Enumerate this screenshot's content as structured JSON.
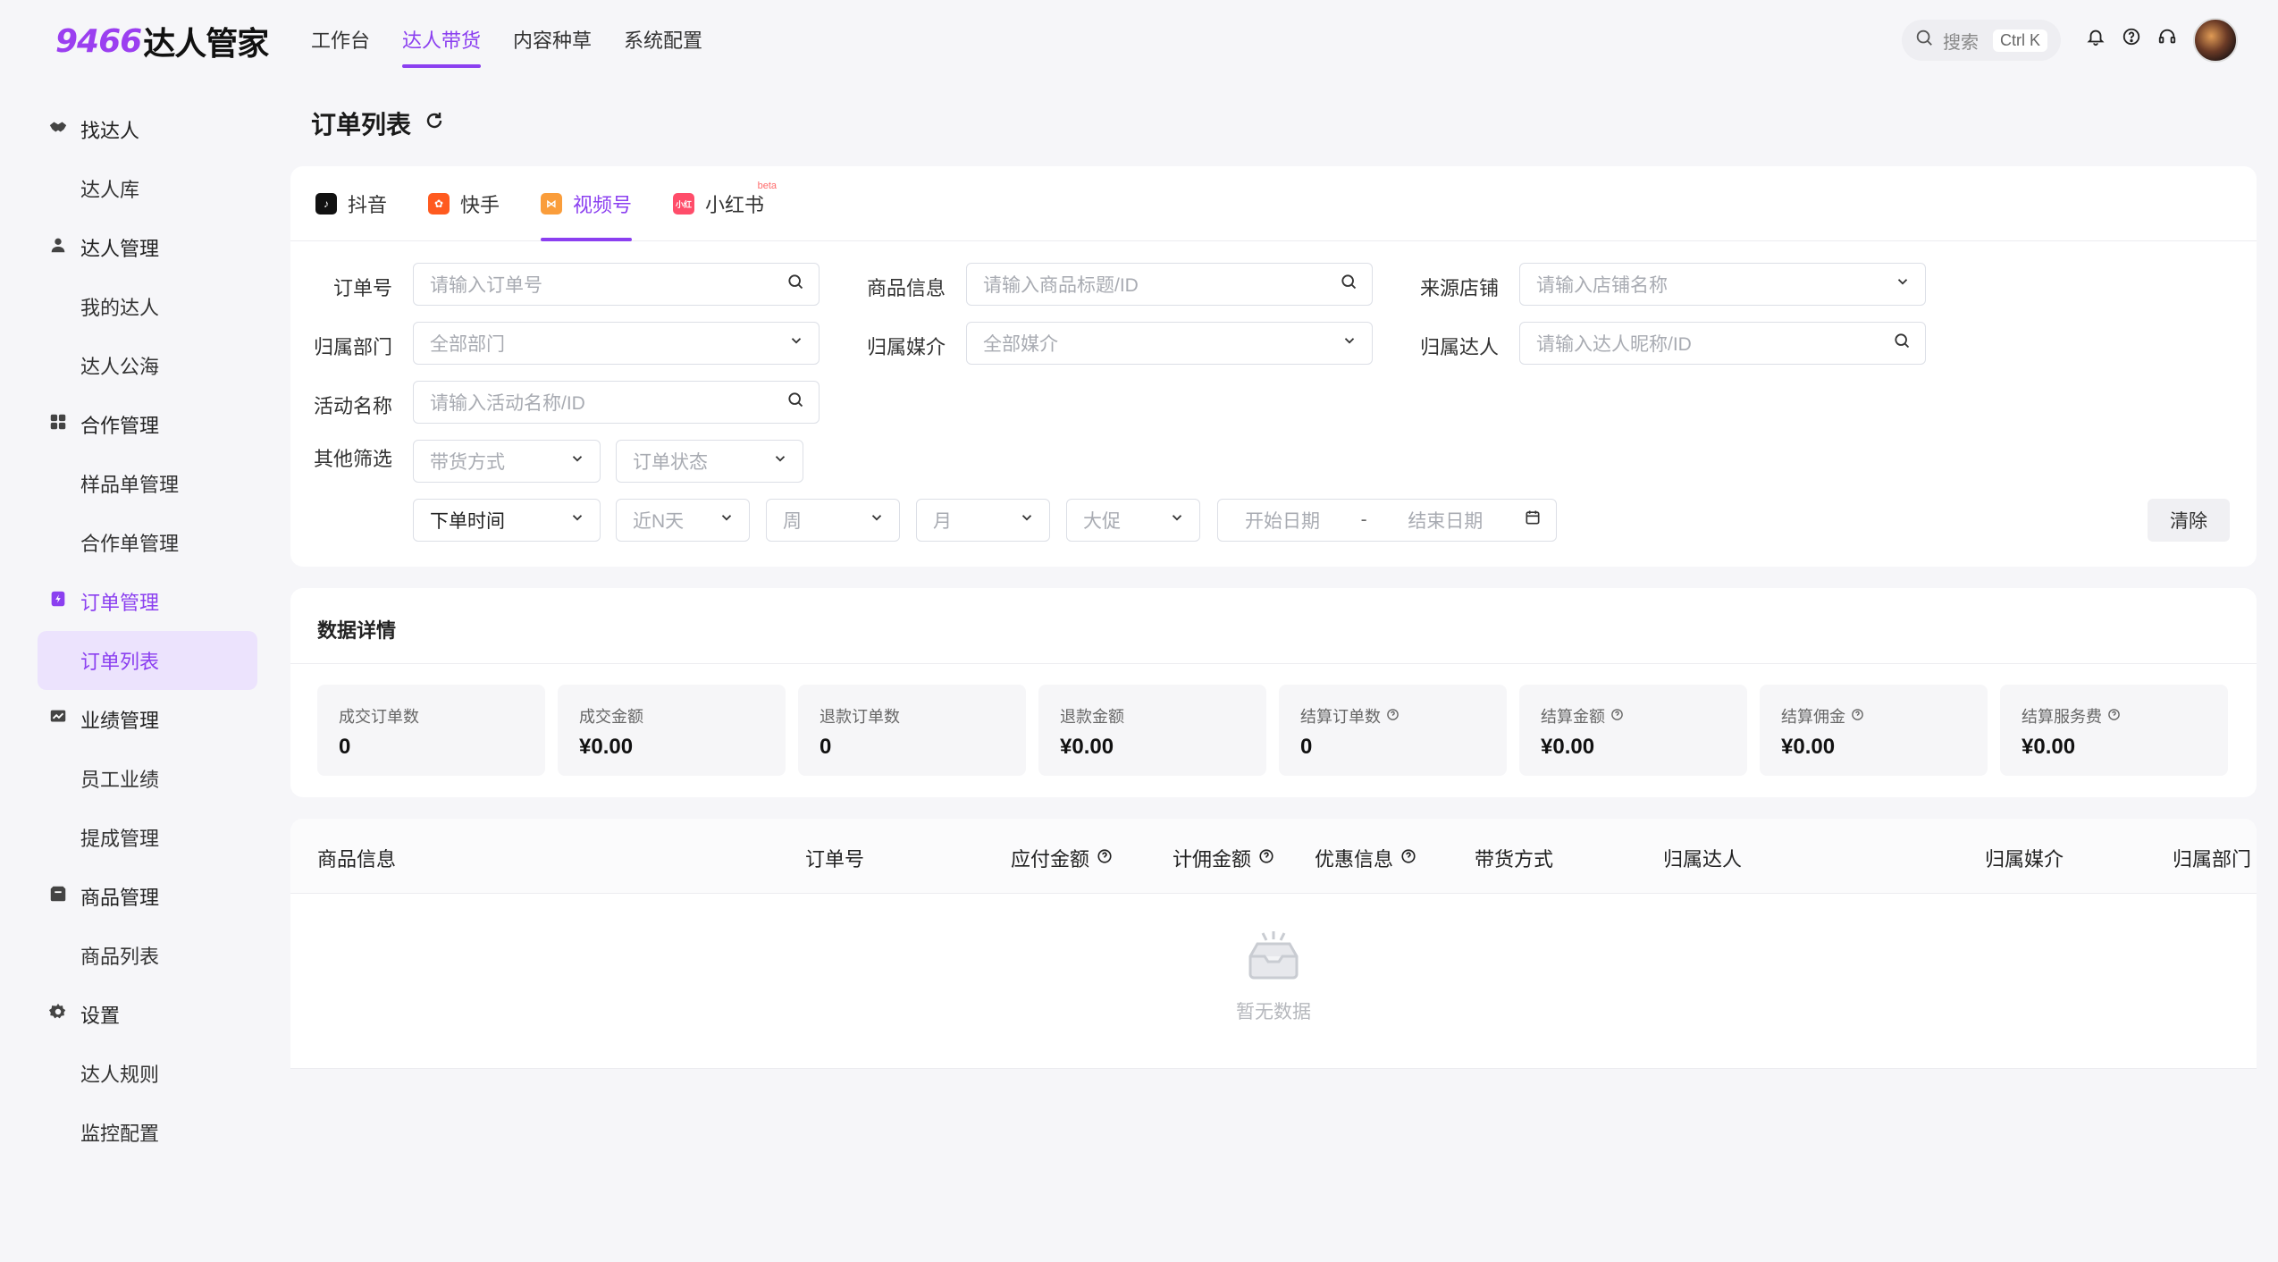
{
  "header": {
    "logo_num": "9466",
    "logo_text": "达人管家",
    "nav": [
      {
        "label": "工作台",
        "active": false
      },
      {
        "label": "达人带货",
        "active": true
      },
      {
        "label": "内容种草",
        "active": false
      },
      {
        "label": "系统配置",
        "active": false
      }
    ],
    "search_placeholder": "搜索",
    "search_shortcut": "Ctrl K"
  },
  "sidebar": {
    "groups": [
      {
        "label": "找达人",
        "icon": "handshake-icon",
        "items": [
          "达人库"
        ]
      },
      {
        "label": "达人管理",
        "icon": "user-icon",
        "items": [
          "我的达人",
          "达人公海"
        ]
      },
      {
        "label": "合作管理",
        "icon": "grid-icon",
        "items": [
          "样品单管理",
          "合作单管理"
        ]
      },
      {
        "label": "订单管理",
        "icon": "order-icon",
        "items": [
          "订单列表"
        ],
        "active": true
      },
      {
        "label": "业绩管理",
        "icon": "chart-icon",
        "items": [
          "员工业绩",
          "提成管理"
        ]
      },
      {
        "label": "商品管理",
        "icon": "box-icon",
        "items": [
          "商品列表"
        ]
      },
      {
        "label": "设置",
        "icon": "gear-icon",
        "items": [
          "达人规则",
          "监控配置"
        ]
      }
    ],
    "active_item": "订单列表"
  },
  "page": {
    "title": "订单列表"
  },
  "tabs": [
    {
      "label": "抖音",
      "active": false
    },
    {
      "label": "快手",
      "active": false
    },
    {
      "label": "视频号",
      "active": true
    },
    {
      "label": "小红书",
      "active": false,
      "badge": "beta"
    }
  ],
  "filters": {
    "order_no": {
      "label": "订单号",
      "placeholder": "请输入订单号"
    },
    "product": {
      "label": "商品信息",
      "placeholder": "请输入商品标题/ID"
    },
    "shop": {
      "label": "来源店铺",
      "placeholder": "请输入店铺名称"
    },
    "dept": {
      "label": "归属部门",
      "placeholder": "全部部门"
    },
    "media": {
      "label": "归属媒介",
      "placeholder": "全部媒介"
    },
    "talent": {
      "label": "归属达人",
      "placeholder": "请输入达人昵称/ID"
    },
    "activity": {
      "label": "活动名称",
      "placeholder": "请输入活动名称/ID"
    },
    "other_label": "其他筛选",
    "sell_mode": "带货方式",
    "order_status": "订单状态",
    "time_type": "下单时间",
    "recent_days": "近N天",
    "week": "周",
    "month": "月",
    "promo": "大促",
    "start_date": "开始日期",
    "date_sep": "-",
    "end_date": "结束日期",
    "clear": "清除"
  },
  "stats": {
    "title": "数据详情",
    "items": [
      {
        "label": "成交订单数",
        "value": "0",
        "help": false
      },
      {
        "label": "成交金额",
        "value": "¥0.00",
        "help": false
      },
      {
        "label": "退款订单数",
        "value": "0",
        "help": false
      },
      {
        "label": "退款金额",
        "value": "¥0.00",
        "help": false
      },
      {
        "label": "结算订单数",
        "value": "0",
        "help": true
      },
      {
        "label": "结算金额",
        "value": "¥0.00",
        "help": true
      },
      {
        "label": "结算佣金",
        "value": "¥0.00",
        "help": true
      },
      {
        "label": "结算服务费",
        "value": "¥0.00",
        "help": true
      }
    ]
  },
  "table": {
    "columns": [
      {
        "label": "商品信息",
        "help": false
      },
      {
        "label": "订单号",
        "help": false
      },
      {
        "label": "应付金额",
        "help": true
      },
      {
        "label": "计佣金额",
        "help": true
      },
      {
        "label": "优惠信息",
        "help": true
      },
      {
        "label": "带货方式",
        "help": false
      },
      {
        "label": "归属达人",
        "help": false
      },
      {
        "label": "归属媒介",
        "help": false
      },
      {
        "label": "归属部门",
        "help": false
      }
    ],
    "empty_text": "暂无数据"
  },
  "colors": {
    "accent": "#8b3ff0",
    "bg": "#f6f6f9"
  }
}
